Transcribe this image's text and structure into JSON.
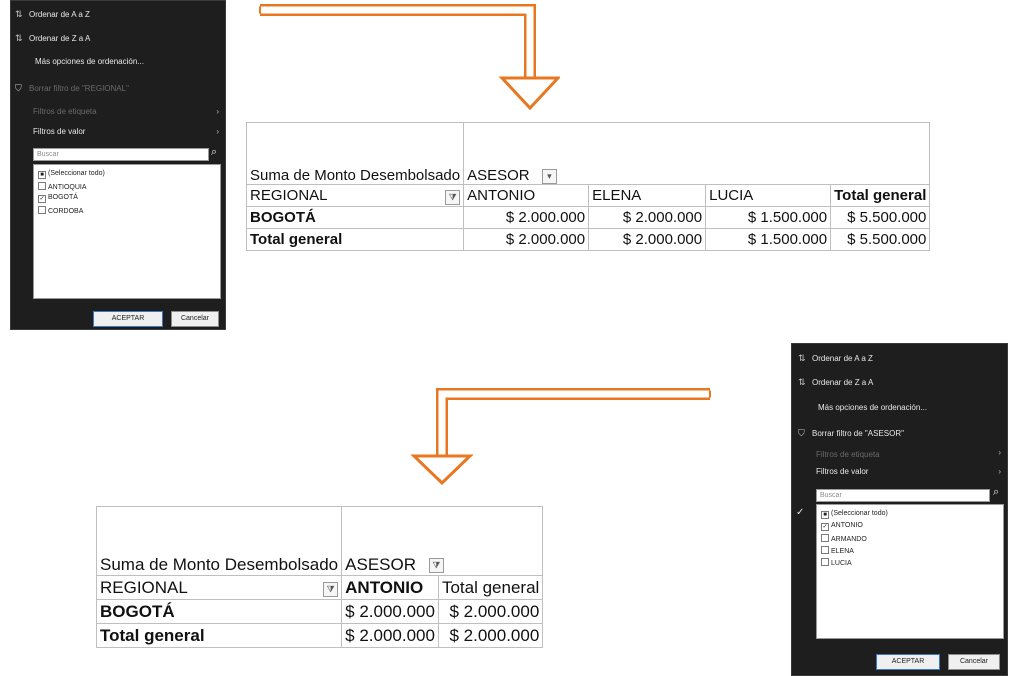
{
  "colors": {
    "arrow": "#E87722",
    "menu_bg": "#1e1e1e"
  },
  "menu1": {
    "sort_az": "Ordenar de A a Z",
    "sort_za": "Ordenar de Z a A",
    "more_sort": "Más opciones de ordenación...",
    "clear_filter": "Borrar filtro de \"REGIONAL\"",
    "label_filters": "Filtros de etiqueta",
    "value_filters": "Filtros de valor",
    "search_placeholder": "Buscar",
    "items": [
      {
        "label": "(Seleccionar todo)",
        "state": "partial"
      },
      {
        "label": "ANTIOQUIA",
        "state": "unchecked"
      },
      {
        "label": "BOGOTÁ",
        "state": "checked"
      },
      {
        "label": "CORDOBA",
        "state": "unchecked"
      }
    ],
    "ok": "ACEPTAR",
    "cancel": "Cancelar"
  },
  "menu2": {
    "sort_az": "Ordenar de A a Z",
    "sort_za": "Ordenar de Z a A",
    "more_sort": "Más opciones de ordenación...",
    "clear_filter": "Borrar filtro de \"ASESOR\"",
    "label_filters": "Filtros de etiqueta",
    "value_filters": "Filtros de valor",
    "search_placeholder": "Buscar",
    "items": [
      {
        "label": "(Seleccionar todo)",
        "state": "partial"
      },
      {
        "label": "ANTONIO",
        "state": "checked"
      },
      {
        "label": "ARMANDO",
        "state": "unchecked"
      },
      {
        "label": "ELENA",
        "state": "unchecked"
      },
      {
        "label": "LUCIA",
        "state": "unchecked"
      }
    ],
    "ok": "ACEPTAR",
    "cancel": "Cancelar"
  },
  "pivot1": {
    "value_field": "Suma de Monto Desembolsado",
    "col_field": "ASESOR",
    "row_field": "REGIONAL",
    "columns": [
      "ANTONIO",
      "ELENA",
      "LUCIA",
      "Total general"
    ],
    "rows": [
      {
        "label": "BOGOTÁ",
        "values": [
          "$ 2.000.000",
          "$ 2.000.000",
          "$ 1.500.000",
          "$ 5.500.000"
        ]
      },
      {
        "label": "Total general",
        "values": [
          "$ 2.000.000",
          "$ 2.000.000",
          "$ 1.500.000",
          "$ 5.500.000"
        ]
      }
    ]
  },
  "pivot2": {
    "value_field": "Suma de Monto Desembolsado",
    "col_field": "ASESOR",
    "row_field": "REGIONAL",
    "columns": [
      "ANTONIO",
      "Total general"
    ],
    "rows": [
      {
        "label": "BOGOTÁ",
        "values": [
          "$ 2.000.000",
          "$ 2.000.000"
        ]
      },
      {
        "label": "Total general",
        "values": [
          "$ 2.000.000",
          "$ 2.000.000"
        ]
      }
    ]
  }
}
